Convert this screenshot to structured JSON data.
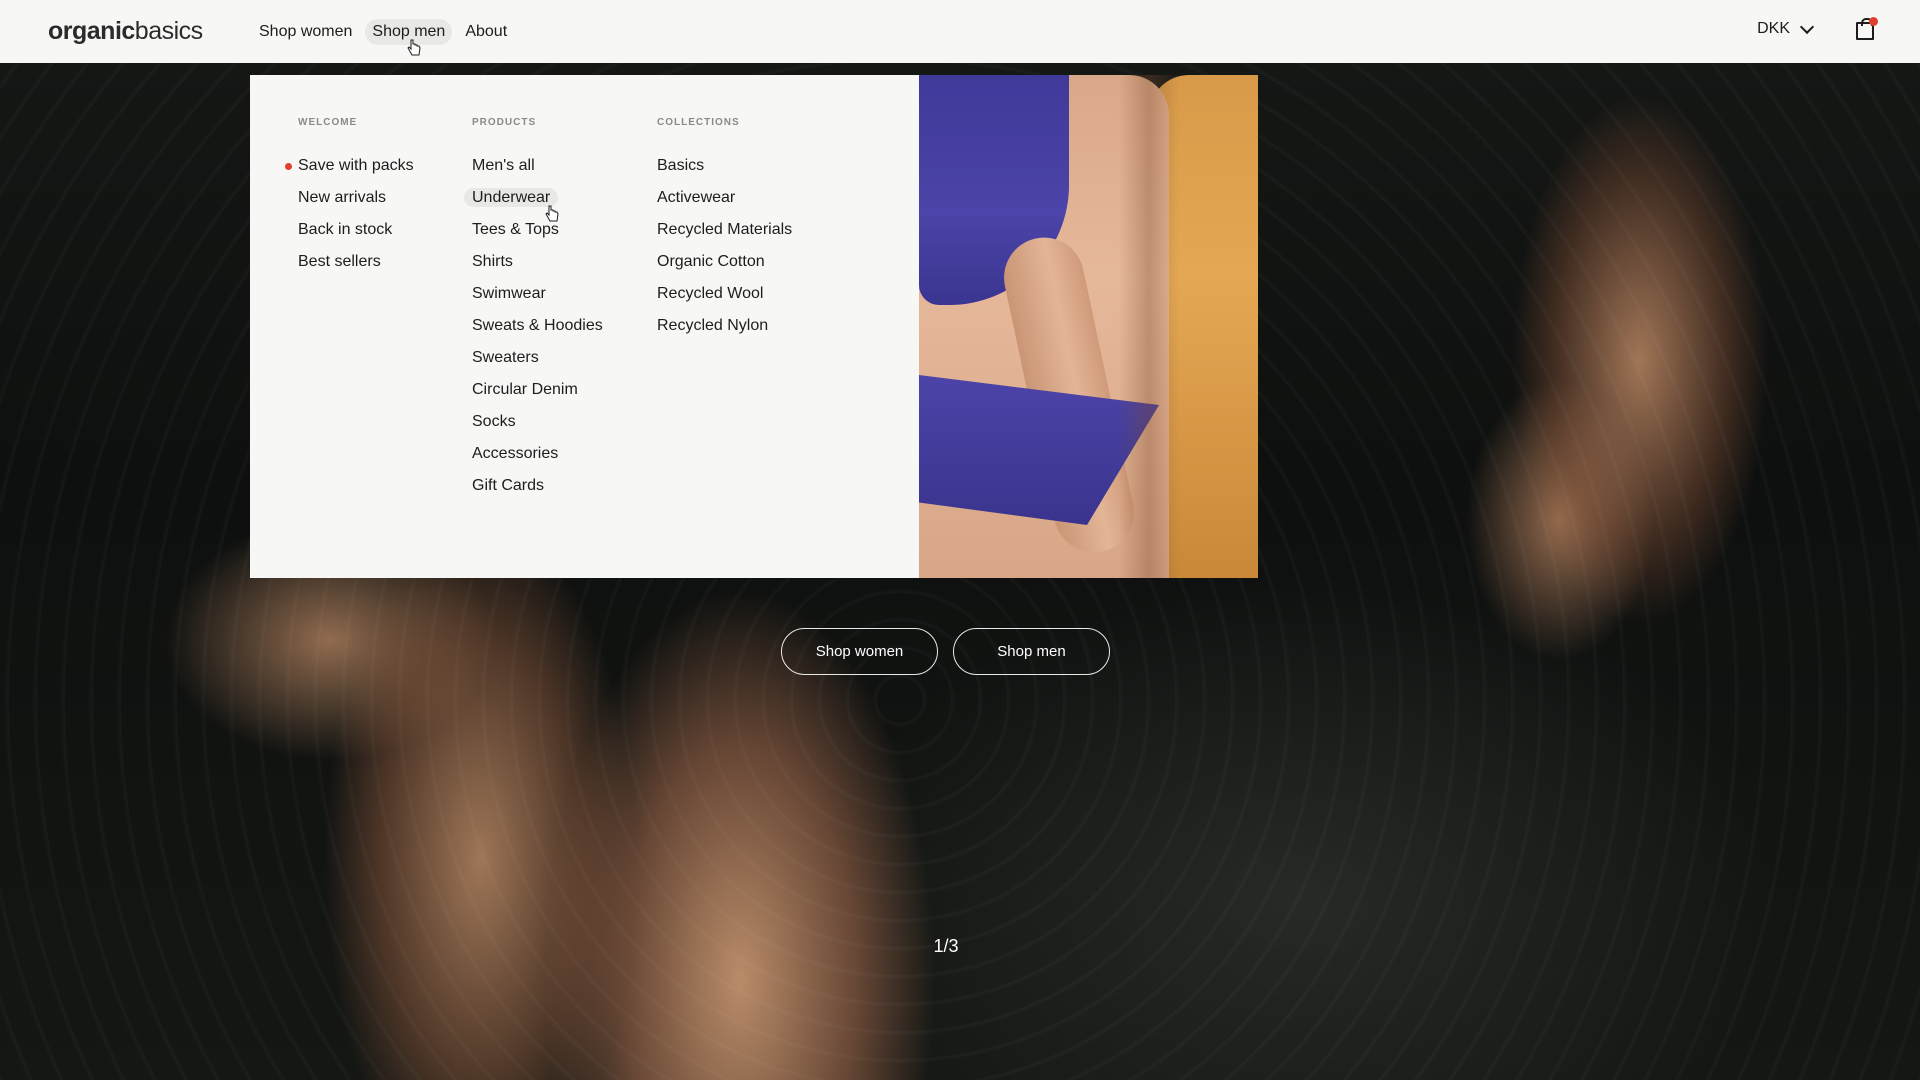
{
  "header": {
    "logo_bold": "organic",
    "logo_light": "basics",
    "nav": [
      {
        "label": "Shop women"
      },
      {
        "label": "Shop men"
      },
      {
        "label": "About"
      }
    ],
    "currency": "DKK",
    "accent_color": "#e04030"
  },
  "mega_menu": {
    "welcome": {
      "heading": "WELCOME",
      "items": [
        "Save with packs",
        "New arrivals",
        "Back in stock",
        "Best sellers"
      ]
    },
    "products": {
      "heading": "PRODUCTS",
      "items": [
        "Men's all",
        "Underwear",
        "Tees & Tops",
        "Shirts",
        "Swimwear",
        "Sweats & Hoodies",
        "Sweaters",
        "Circular Denim",
        "Socks",
        "Accessories",
        "Gift Cards"
      ]
    },
    "collections": {
      "heading": "COLLECTIONS",
      "items": [
        "Basics",
        "Activewear",
        "Recycled Materials",
        "Organic Cotton",
        "Recycled Wool",
        "Recycled Nylon"
      ]
    }
  },
  "hero": {
    "cta_women": "Shop women",
    "cta_men": "Shop men",
    "slide_counter": "1/3"
  },
  "icons": {
    "currency_toggle": "chevron-down-icon",
    "cart": "shopping-bag-icon"
  }
}
